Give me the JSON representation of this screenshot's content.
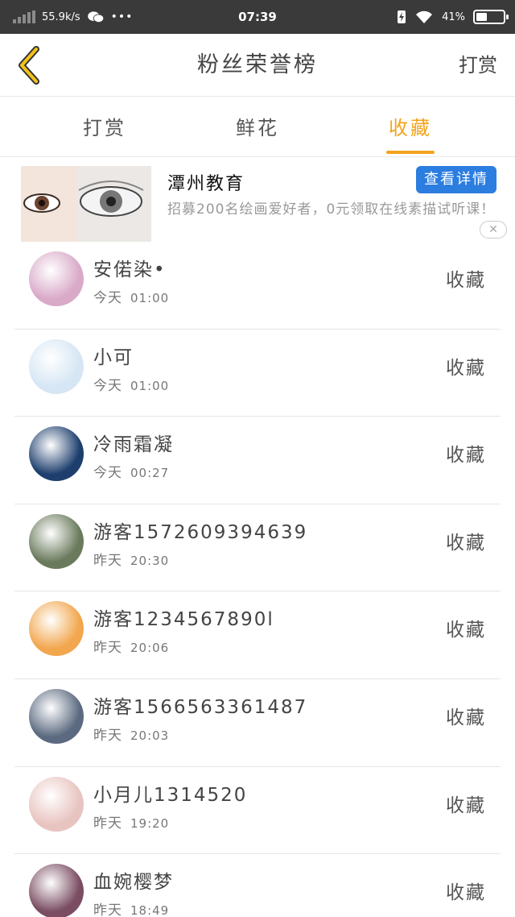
{
  "status_bar": {
    "speed": "55.9k/s",
    "dots": "•••",
    "time": "07:39",
    "battery": "41%",
    "battery_level": 0.41
  },
  "nav": {
    "title": "粉丝荣誉榜",
    "right": "打赏"
  },
  "tabs": [
    {
      "label": "打赏",
      "active": false
    },
    {
      "label": "鲜花",
      "active": false
    },
    {
      "label": "收藏",
      "active": true
    }
  ],
  "ad": {
    "title": "潭州教育",
    "button": "查看详情",
    "description": "招募200名绘画爱好者，0元领取在线素描试听课！",
    "close": "✕"
  },
  "fans": [
    {
      "name": "安偌染•",
      "day": "今天",
      "clock": "01:00",
      "action": "收藏",
      "avatar_color": "#d9a9c8"
    },
    {
      "name": "小可",
      "day": "今天",
      "clock": "01:00",
      "action": "收藏",
      "avatar_color": "#d6e6f4"
    },
    {
      "name": "冷雨霜凝",
      "day": "今天",
      "clock": "00:27",
      "action": "收藏",
      "avatar_color": "#1e3f6e"
    },
    {
      "name": "游客1572609394639",
      "day": "昨天",
      "clock": "20:30",
      "action": "收藏",
      "avatar_color": "#6a7a5c"
    },
    {
      "name": "游客1234567890l",
      "day": "昨天",
      "clock": "20:06",
      "action": "收藏",
      "avatar_color": "#f2a64d"
    },
    {
      "name": "游客1566563361487",
      "day": "昨天",
      "clock": "20:03",
      "action": "收藏",
      "avatar_color": "#5b6a80"
    },
    {
      "name": "小月儿1314520",
      "day": "昨天",
      "clock": "19:20",
      "action": "收藏",
      "avatar_color": "#e8c4c0"
    },
    {
      "name": "血婉樱梦",
      "day": "昨天",
      "clock": "18:49",
      "action": "收藏",
      "avatar_color": "#7a4d62"
    }
  ],
  "colors": {
    "accent": "#f3a31b",
    "ad_button": "#2c7de0",
    "status_bar": "#3a3a3a"
  },
  "icons": {
    "back": "chevron-left-icon",
    "signal": "signal-icon",
    "wechat": "wechat-icon",
    "wifi": "wifi-icon",
    "battery": "battery-icon",
    "close": "close-icon"
  }
}
